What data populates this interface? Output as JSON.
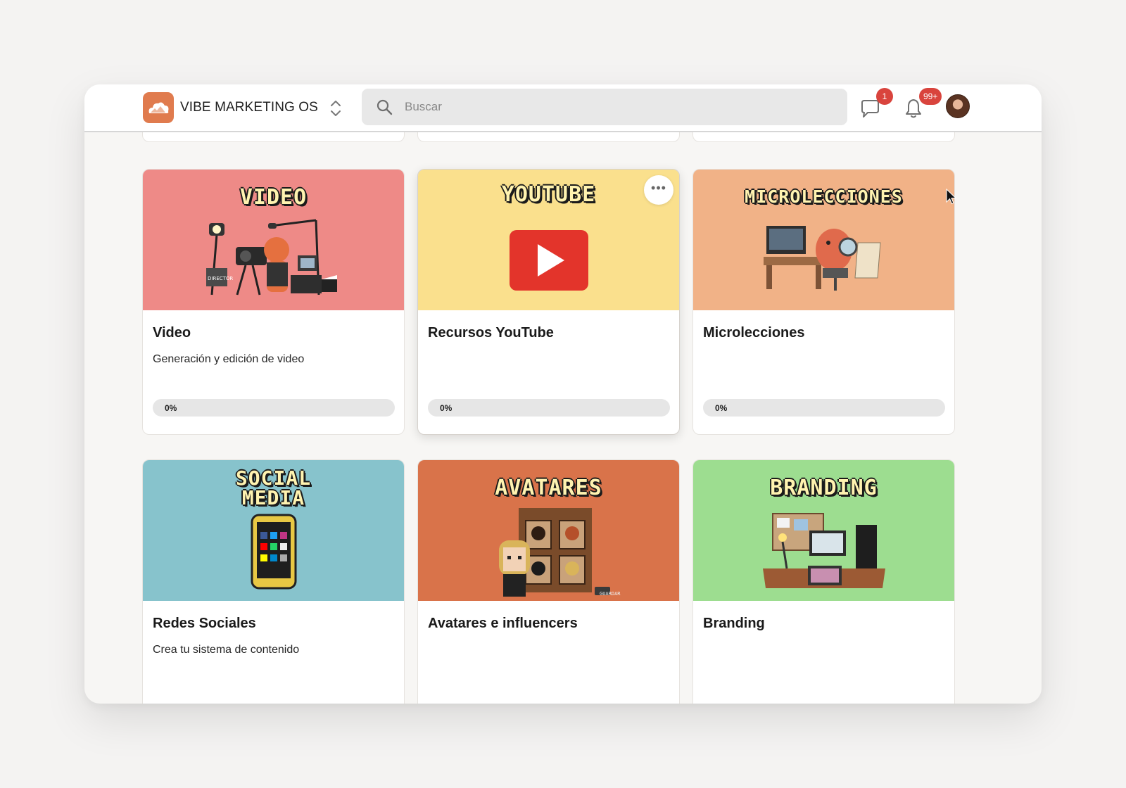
{
  "header": {
    "app_name": "VIBE MARKETING OS",
    "search_placeholder": "Buscar",
    "messages_badge": "1",
    "notifications_badge": "99+",
    "brand_color": "#e07b4e",
    "badge_color": "#d9443d"
  },
  "cards": [
    {
      "banner_text": "VIDEO",
      "banner_color": "#ee8a87",
      "title": "Video",
      "description": "Generación y edición de video",
      "progress_label": "0%",
      "progress_value": 0,
      "illustration": "film-crew-illustration"
    },
    {
      "banner_text": "YOUTUBE",
      "banner_color": "#fae08d",
      "title": "Recursos YouTube",
      "description": "",
      "progress_label": "0%",
      "progress_value": 0,
      "illustration": "youtube-play-icon"
    },
    {
      "banner_text": "MICROLECCIONES",
      "banner_color": "#f1b287",
      "title": "Microlecciones",
      "description": "",
      "progress_label": "0%",
      "progress_value": 0,
      "illustration": "desk-character-illustration"
    },
    {
      "banner_text_line1": "SOCIAL",
      "banner_text_line2": "MEDIA",
      "banner_color": "#87c3cc",
      "title": "Redes Sociales",
      "description": "Crea tu sistema de contenido",
      "illustration": "smartphone-apps-illustration"
    },
    {
      "banner_text": "AVATARES",
      "banner_color": "#d9734a",
      "banner_caption": "GUARDAR",
      "title": "Avatares e influencers",
      "description": "",
      "illustration": "avatar-portraits-illustration"
    },
    {
      "banner_text": "BRANDING",
      "banner_color": "#9ddd90",
      "title": "Branding",
      "description": "",
      "illustration": "design-desk-illustration"
    }
  ]
}
